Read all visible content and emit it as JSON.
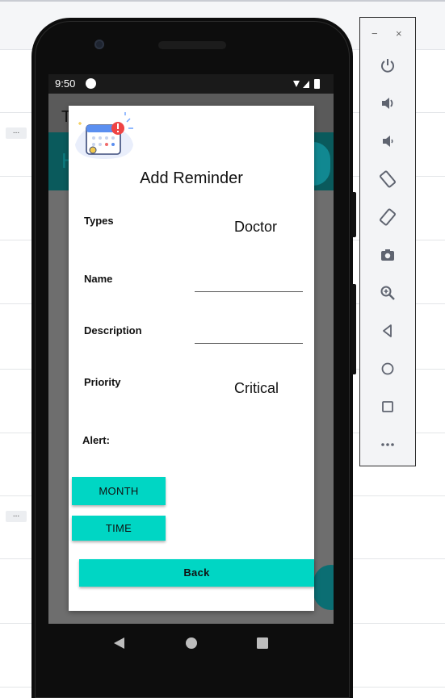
{
  "background": {
    "more_label_1": "...",
    "more_label_2": "..."
  },
  "device": {
    "status_time": "9:50",
    "appbar_initial": "T",
    "banner_initial": "H"
  },
  "dialog": {
    "title": "Add Reminder",
    "fields": {
      "types_label": "Types",
      "types_value": "Doctor",
      "name_label": "Name",
      "description_label": "Description",
      "priority_label": "Priority",
      "priority_value": "Critical",
      "alert_label": "Alert:"
    },
    "buttons": {
      "month": "MONTH",
      "time": "TIME",
      "back": "Back"
    }
  },
  "emulator_panel": {
    "minimize": "−",
    "close": "×",
    "items": [
      "power-icon",
      "volume-up-icon",
      "volume-down-icon",
      "rotate-left-icon",
      "rotate-right-icon",
      "camera-icon",
      "zoom-icon",
      "back-icon",
      "home-icon",
      "overview-icon",
      "more-icon"
    ]
  },
  "colors": {
    "accent": "#00d6c4",
    "icon": "#5f6470"
  }
}
